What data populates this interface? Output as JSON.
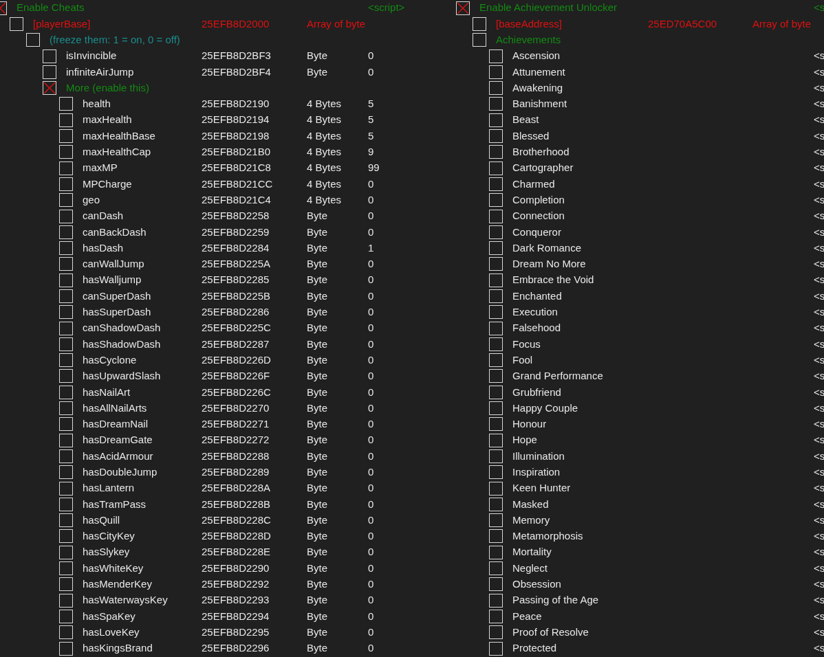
{
  "panels": [
    {
      "entries": [
        {
          "kind": "script",
          "name": "Enable Cheats",
          "checked": true,
          "value": "<script>",
          "children": [
            {
              "kind": "base",
              "name": "[playerBase]",
              "checked": false,
              "address": "25EFB8D2000",
              "type": "Array of byte",
              "children": [
                {
                  "kind": "header",
                  "name": "(freeze them: 1 = on, 0 = off)",
                  "checked": false,
                  "children": [
                    {
                      "kind": "entry",
                      "name": "isInvincible",
                      "checked": false,
                      "address": "25EFB8D2BF3",
                      "type": "Byte",
                      "value": "0"
                    },
                    {
                      "kind": "entry",
                      "name": "infiniteAirJump",
                      "checked": false,
                      "address": "25EFB8D2BF4",
                      "type": "Byte",
                      "value": "0"
                    },
                    {
                      "kind": "group",
                      "name": "More (enable this)",
                      "checked": true,
                      "children": [
                        {
                          "kind": "entry",
                          "name": "health",
                          "checked": false,
                          "address": "25EFB8D2190",
                          "type": "4 Bytes",
                          "value": "5"
                        },
                        {
                          "kind": "entry",
                          "name": "maxHealth",
                          "checked": false,
                          "address": "25EFB8D2194",
                          "type": "4 Bytes",
                          "value": "5"
                        },
                        {
                          "kind": "entry",
                          "name": "maxHealthBase",
                          "checked": false,
                          "address": "25EFB8D2198",
                          "type": "4 Bytes",
                          "value": "5"
                        },
                        {
                          "kind": "entry",
                          "name": "maxHealthCap",
                          "checked": false,
                          "address": "25EFB8D21B0",
                          "type": "4 Bytes",
                          "value": "9"
                        },
                        {
                          "kind": "entry",
                          "name": "maxMP",
                          "checked": false,
                          "address": "25EFB8D21C8",
                          "type": "4 Bytes",
                          "value": "99"
                        },
                        {
                          "kind": "entry",
                          "name": "MPCharge",
                          "checked": false,
                          "address": "25EFB8D21CC",
                          "type": "4 Bytes",
                          "value": "0"
                        },
                        {
                          "kind": "entry",
                          "name": "geo",
                          "checked": false,
                          "address": "25EFB8D21C4",
                          "type": "4 Bytes",
                          "value": "0"
                        },
                        {
                          "kind": "entry",
                          "name": "canDash",
                          "checked": false,
                          "address": "25EFB8D2258",
                          "type": "Byte",
                          "value": "0"
                        },
                        {
                          "kind": "entry",
                          "name": "canBackDash",
                          "checked": false,
                          "address": "25EFB8D2259",
                          "type": "Byte",
                          "value": "0"
                        },
                        {
                          "kind": "entry",
                          "name": "hasDash",
                          "checked": false,
                          "address": "25EFB8D2284",
                          "type": "Byte",
                          "value": "1"
                        },
                        {
                          "kind": "entry",
                          "name": "canWallJump",
                          "checked": false,
                          "address": "25EFB8D225A",
                          "type": "Byte",
                          "value": "0"
                        },
                        {
                          "kind": "entry",
                          "name": "hasWalljump",
                          "checked": false,
                          "address": "25EFB8D2285",
                          "type": "Byte",
                          "value": "0"
                        },
                        {
                          "kind": "entry",
                          "name": "canSuperDash",
                          "checked": false,
                          "address": "25EFB8D225B",
                          "type": "Byte",
                          "value": "0"
                        },
                        {
                          "kind": "entry",
                          "name": "hasSuperDash",
                          "checked": false,
                          "address": "25EFB8D2286",
                          "type": "Byte",
                          "value": "0"
                        },
                        {
                          "kind": "entry",
                          "name": "canShadowDash",
                          "checked": false,
                          "address": "25EFB8D225C",
                          "type": "Byte",
                          "value": "0"
                        },
                        {
                          "kind": "entry",
                          "name": "hasShadowDash",
                          "checked": false,
                          "address": "25EFB8D2287",
                          "type": "Byte",
                          "value": "0"
                        },
                        {
                          "kind": "entry",
                          "name": "hasCyclone",
                          "checked": false,
                          "address": "25EFB8D226D",
                          "type": "Byte",
                          "value": "0"
                        },
                        {
                          "kind": "entry",
                          "name": "hasUpwardSlash",
                          "checked": false,
                          "address": "25EFB8D226F",
                          "type": "Byte",
                          "value": "0"
                        },
                        {
                          "kind": "entry",
                          "name": "hasNailArt",
                          "checked": false,
                          "address": "25EFB8D226C",
                          "type": "Byte",
                          "value": "0"
                        },
                        {
                          "kind": "entry",
                          "name": "hasAllNailArts",
                          "checked": false,
                          "address": "25EFB8D2270",
                          "type": "Byte",
                          "value": "0"
                        },
                        {
                          "kind": "entry",
                          "name": "hasDreamNail",
                          "checked": false,
                          "address": "25EFB8D2271",
                          "type": "Byte",
                          "value": "0"
                        },
                        {
                          "kind": "entry",
                          "name": "hasDreamGate",
                          "checked": false,
                          "address": "25EFB8D2272",
                          "type": "Byte",
                          "value": "0"
                        },
                        {
                          "kind": "entry",
                          "name": "hasAcidArmour",
                          "checked": false,
                          "address": "25EFB8D2288",
                          "type": "Byte",
                          "value": "0"
                        },
                        {
                          "kind": "entry",
                          "name": "hasDoubleJump",
                          "checked": false,
                          "address": "25EFB8D2289",
                          "type": "Byte",
                          "value": "0"
                        },
                        {
                          "kind": "entry",
                          "name": "hasLantern",
                          "checked": false,
                          "address": "25EFB8D228A",
                          "type": "Byte",
                          "value": "0"
                        },
                        {
                          "kind": "entry",
                          "name": "hasTramPass",
                          "checked": false,
                          "address": "25EFB8D228B",
                          "type": "Byte",
                          "value": "0"
                        },
                        {
                          "kind": "entry",
                          "name": "hasQuill",
                          "checked": false,
                          "address": "25EFB8D228C",
                          "type": "Byte",
                          "value": "0"
                        },
                        {
                          "kind": "entry",
                          "name": "hasCityKey",
                          "checked": false,
                          "address": "25EFB8D228D",
                          "type": "Byte",
                          "value": "0"
                        },
                        {
                          "kind": "entry",
                          "name": "hasSlykey",
                          "checked": false,
                          "address": "25EFB8D228E",
                          "type": "Byte",
                          "value": "0"
                        },
                        {
                          "kind": "entry",
                          "name": "hasWhiteKey",
                          "checked": false,
                          "address": "25EFB8D2290",
                          "type": "Byte",
                          "value": "0"
                        },
                        {
                          "kind": "entry",
                          "name": "hasMenderKey",
                          "checked": false,
                          "address": "25EFB8D2292",
                          "type": "Byte",
                          "value": "0"
                        },
                        {
                          "kind": "entry",
                          "name": "hasWaterwaysKey",
                          "checked": false,
                          "address": "25EFB8D2293",
                          "type": "Byte",
                          "value": "0"
                        },
                        {
                          "kind": "entry",
                          "name": "hasSpaKey",
                          "checked": false,
                          "address": "25EFB8D2294",
                          "type": "Byte",
                          "value": "0"
                        },
                        {
                          "kind": "entry",
                          "name": "hasLoveKey",
                          "checked": false,
                          "address": "25EFB8D2295",
                          "type": "Byte",
                          "value": "0"
                        },
                        {
                          "kind": "entry",
                          "name": "hasKingsBrand",
                          "checked": false,
                          "address": "25EFB8D2296",
                          "type": "Byte",
                          "value": "0"
                        }
                      ]
                    }
                  ]
                }
              ]
            }
          ]
        }
      ]
    },
    {
      "entries": [
        {
          "kind": "script",
          "name": "Enable Achievement Unlocker",
          "checked": true,
          "value": "<s",
          "children": [
            {
              "kind": "base",
              "name": "[baseAddress]",
              "checked": false,
              "address": "25ED70A5C00",
              "type": "Array of byte"
            },
            {
              "kind": "group",
              "name": "Achievements",
              "checked": false,
              "children": [
                {
                  "kind": "entry",
                  "name": "Ascension",
                  "checked": false,
                  "value": "<s"
                },
                {
                  "kind": "entry",
                  "name": "Attunement",
                  "checked": false,
                  "value": "<s"
                },
                {
                  "kind": "entry",
                  "name": "Awakening",
                  "checked": false,
                  "value": "<s"
                },
                {
                  "kind": "entry",
                  "name": "Banishment",
                  "checked": false,
                  "value": "<s"
                },
                {
                  "kind": "entry",
                  "name": "Beast",
                  "checked": false,
                  "value": "<s"
                },
                {
                  "kind": "entry",
                  "name": "Blessed",
                  "checked": false,
                  "value": "<s"
                },
                {
                  "kind": "entry",
                  "name": "Brotherhood",
                  "checked": false,
                  "value": "<s"
                },
                {
                  "kind": "entry",
                  "name": "Cartographer",
                  "checked": false,
                  "value": "<s"
                },
                {
                  "kind": "entry",
                  "name": "Charmed",
                  "checked": false,
                  "value": "<s"
                },
                {
                  "kind": "entry",
                  "name": "Completion",
                  "checked": false,
                  "value": "<s"
                },
                {
                  "kind": "entry",
                  "name": "Connection",
                  "checked": false,
                  "value": "<s"
                },
                {
                  "kind": "entry",
                  "name": "Conqueror",
                  "checked": false,
                  "value": "<s"
                },
                {
                  "kind": "entry",
                  "name": "Dark Romance",
                  "checked": false,
                  "value": "<s"
                },
                {
                  "kind": "entry",
                  "name": "Dream No More",
                  "checked": false,
                  "value": "<s"
                },
                {
                  "kind": "entry",
                  "name": "Embrace the Void",
                  "checked": false,
                  "value": "<s"
                },
                {
                  "kind": "entry",
                  "name": "Enchanted",
                  "checked": false,
                  "value": "<s"
                },
                {
                  "kind": "entry",
                  "name": "Execution",
                  "checked": false,
                  "value": "<s"
                },
                {
                  "kind": "entry",
                  "name": "Falsehood",
                  "checked": false,
                  "value": "<s"
                },
                {
                  "kind": "entry",
                  "name": "Focus",
                  "checked": false,
                  "value": "<s"
                },
                {
                  "kind": "entry",
                  "name": "Fool",
                  "checked": false,
                  "value": "<s"
                },
                {
                  "kind": "entry",
                  "name": "Grand Performance",
                  "checked": false,
                  "value": "<s"
                },
                {
                  "kind": "entry",
                  "name": "Grubfriend",
                  "checked": false,
                  "value": "<s"
                },
                {
                  "kind": "entry",
                  "name": "Happy Couple",
                  "checked": false,
                  "value": "<s"
                },
                {
                  "kind": "entry",
                  "name": "Honour",
                  "checked": false,
                  "value": "<s"
                },
                {
                  "kind": "entry",
                  "name": "Hope",
                  "checked": false,
                  "value": "<s"
                },
                {
                  "kind": "entry",
                  "name": "Illumination",
                  "checked": false,
                  "value": "<s"
                },
                {
                  "kind": "entry",
                  "name": "Inspiration",
                  "checked": false,
                  "value": "<s"
                },
                {
                  "kind": "entry",
                  "name": "Keen Hunter",
                  "checked": false,
                  "value": "<s"
                },
                {
                  "kind": "entry",
                  "name": "Masked",
                  "checked": false,
                  "value": "<s"
                },
                {
                  "kind": "entry",
                  "name": "Memory",
                  "checked": false,
                  "value": "<s"
                },
                {
                  "kind": "entry",
                  "name": "Metamorphosis",
                  "checked": false,
                  "value": "<s"
                },
                {
                  "kind": "entry",
                  "name": "Mortality",
                  "checked": false,
                  "value": "<s"
                },
                {
                  "kind": "entry",
                  "name": "Neglect",
                  "checked": false,
                  "value": "<s"
                },
                {
                  "kind": "entry",
                  "name": "Obsession",
                  "checked": false,
                  "value": "<s"
                },
                {
                  "kind": "entry",
                  "name": "Passing of the Age",
                  "checked": false,
                  "value": "<s"
                },
                {
                  "kind": "entry",
                  "name": "Peace",
                  "checked": false,
                  "value": "<s"
                },
                {
                  "kind": "entry",
                  "name": "Proof of Resolve",
                  "checked": false,
                  "value": "<s"
                },
                {
                  "kind": "entry",
                  "name": "Protected",
                  "checked": false,
                  "value": "<s"
                }
              ]
            }
          ]
        }
      ]
    }
  ]
}
